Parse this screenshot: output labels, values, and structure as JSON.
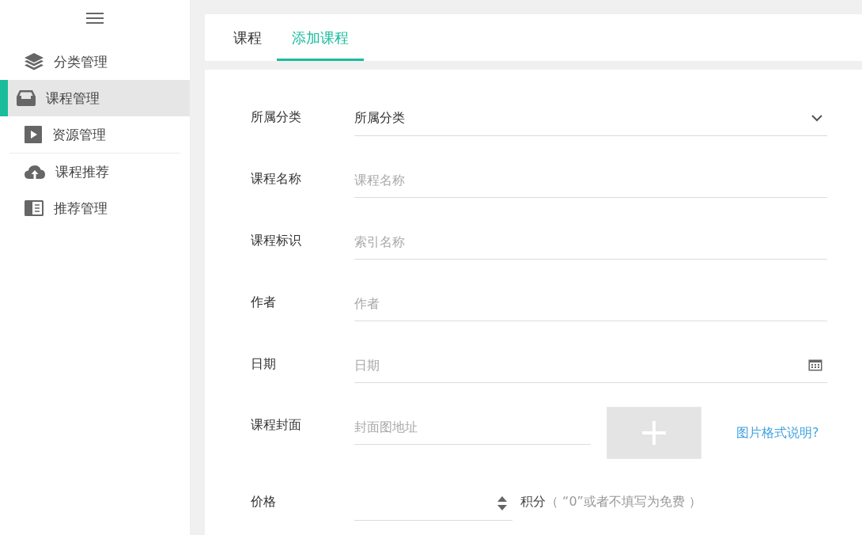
{
  "sidebar": {
    "groups": [
      {
        "items": [
          {
            "label": "分类管理",
            "selected": false
          },
          {
            "label": "课程管理",
            "selected": true
          },
          {
            "label": "资源管理",
            "selected": false
          }
        ]
      },
      {
        "items": [
          {
            "label": "课程推荐",
            "selected": false
          },
          {
            "label": "推荐管理",
            "selected": false
          }
        ]
      }
    ]
  },
  "tabs": [
    {
      "label": "课程",
      "selected": false
    },
    {
      "label": "添加课程",
      "selected": true
    }
  ],
  "form": {
    "rows": [
      {
        "kind": "select",
        "label": "所属分类",
        "value": "所属分类"
      },
      {
        "kind": "text",
        "label": "课程名称",
        "placeholder": "课程名称"
      },
      {
        "kind": "text",
        "label": "课程标识",
        "placeholder": "索引名称"
      },
      {
        "kind": "text",
        "label": "作者",
        "placeholder": "作者"
      },
      {
        "kind": "date",
        "label": "日期",
        "placeholder": "日期"
      },
      {
        "kind": "cover",
        "label": "课程封面",
        "placeholder": "封面图地址",
        "link": "图片格式说明?"
      },
      {
        "kind": "price",
        "label": "价格",
        "unit": "积分",
        "note": "（ “0”或者不填写为免费 ）"
      }
    ]
  }
}
